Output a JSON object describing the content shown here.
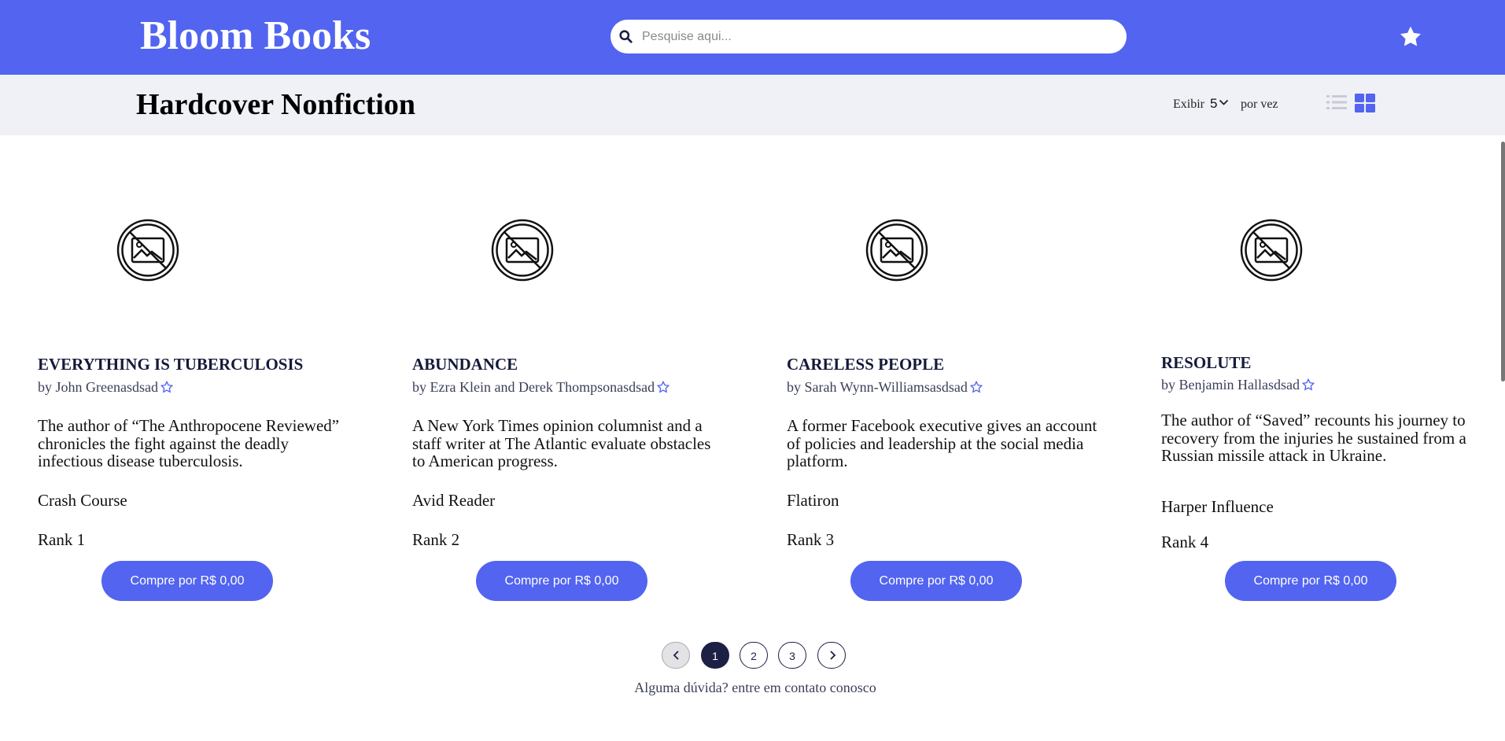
{
  "header": {
    "logo": "Bloom Books",
    "search_placeholder": "Pesquise aqui...",
    "search_value": ""
  },
  "subbar": {
    "title": "Hardcover Nonfiction",
    "show_label": "Exibir",
    "per_page_value": "5",
    "per_label": "por vez",
    "active_view": "grid"
  },
  "books": [
    {
      "title": "EVERYTHING IS TUBERCULOSIS",
      "author": "by John Greenasdsad",
      "description": "The author of “The Anthropocene Reviewed” chronicles the fight against the deadly infectious disease tuberculosis.",
      "publisher": "Crash Course",
      "rank": "Rank 1",
      "buy_label": "Compre por R$ 0,00"
    },
    {
      "title": "ABUNDANCE",
      "author": "by Ezra Klein and Derek Thompsonasdsad",
      "description": "A New York Times opinion columnist and a staff writer at The Atlantic evaluate obstacles to American progress.",
      "publisher": "Avid Reader",
      "rank": "Rank 2",
      "buy_label": "Compre por R$ 0,00"
    },
    {
      "title": "CARELESS PEOPLE",
      "author": "by Sarah Wynn-Williamsasdsad",
      "description": "A former Facebook executive gives an account of policies and leadership at the social media platform.",
      "publisher": "Flatiron",
      "rank": "Rank 3",
      "buy_label": "Compre por R$ 0,00"
    },
    {
      "title": "RESOLUTE",
      "author": "by Benjamin Hallasdsad",
      "description": "The author of “Saved” recounts his journey to recovery from the injuries he sustained from a Russian missile attack in Ukraine.",
      "publisher": "Harper Influence",
      "rank": "Rank 4",
      "buy_label": "Compre por R$ 0,00"
    }
  ],
  "pagination": {
    "pages": [
      "1",
      "2",
      "3"
    ],
    "current": "1"
  },
  "footer": {
    "contact": "Alguma dúvida? entre em contato conosco"
  },
  "colors": {
    "brand": "#5264f0",
    "dark": "#1d2045",
    "subbar_bg": "#f0f1f6"
  }
}
